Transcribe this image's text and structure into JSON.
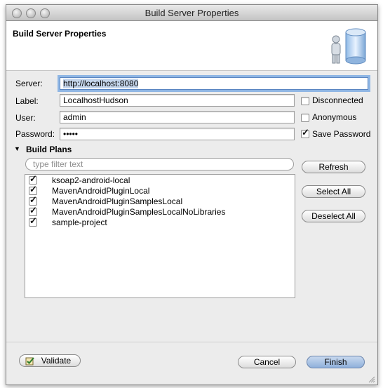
{
  "window": {
    "title": "Build Server Properties"
  },
  "header": {
    "title": "Build Server Properties",
    "banner_icon": "server-database-icon"
  },
  "form": {
    "server_label": "Server:",
    "server_value": "http://localhost:8080",
    "label_label": "Label:",
    "label_value": "LocalhostHudson",
    "user_label": "User:",
    "user_value": "admin",
    "password_label": "Password:",
    "password_value": "•••••",
    "disconnected_label": "Disconnected",
    "disconnected_checked": false,
    "anonymous_label": "Anonymous",
    "anonymous_checked": false,
    "save_password_label": "Save Password",
    "save_password_checked": true
  },
  "build_plans": {
    "section_label": "Build Plans",
    "filter_placeholder": "type filter text",
    "items": [
      {
        "name": "ksoap2-android-local",
        "checked": true
      },
      {
        "name": "MavenAndroidPluginLocal",
        "checked": true
      },
      {
        "name": "MavenAndroidPluginSamplesLocal",
        "checked": true
      },
      {
        "name": "MavenAndroidPluginSamplesLocalNoLibraries",
        "checked": true
      },
      {
        "name": "sample-project",
        "checked": true
      }
    ],
    "refresh_label": "Refresh",
    "select_all_label": "Select All",
    "deselect_all_label": "Deselect All"
  },
  "footer": {
    "validate_label": "Validate",
    "cancel_label": "Cancel",
    "finish_label": "Finish"
  }
}
